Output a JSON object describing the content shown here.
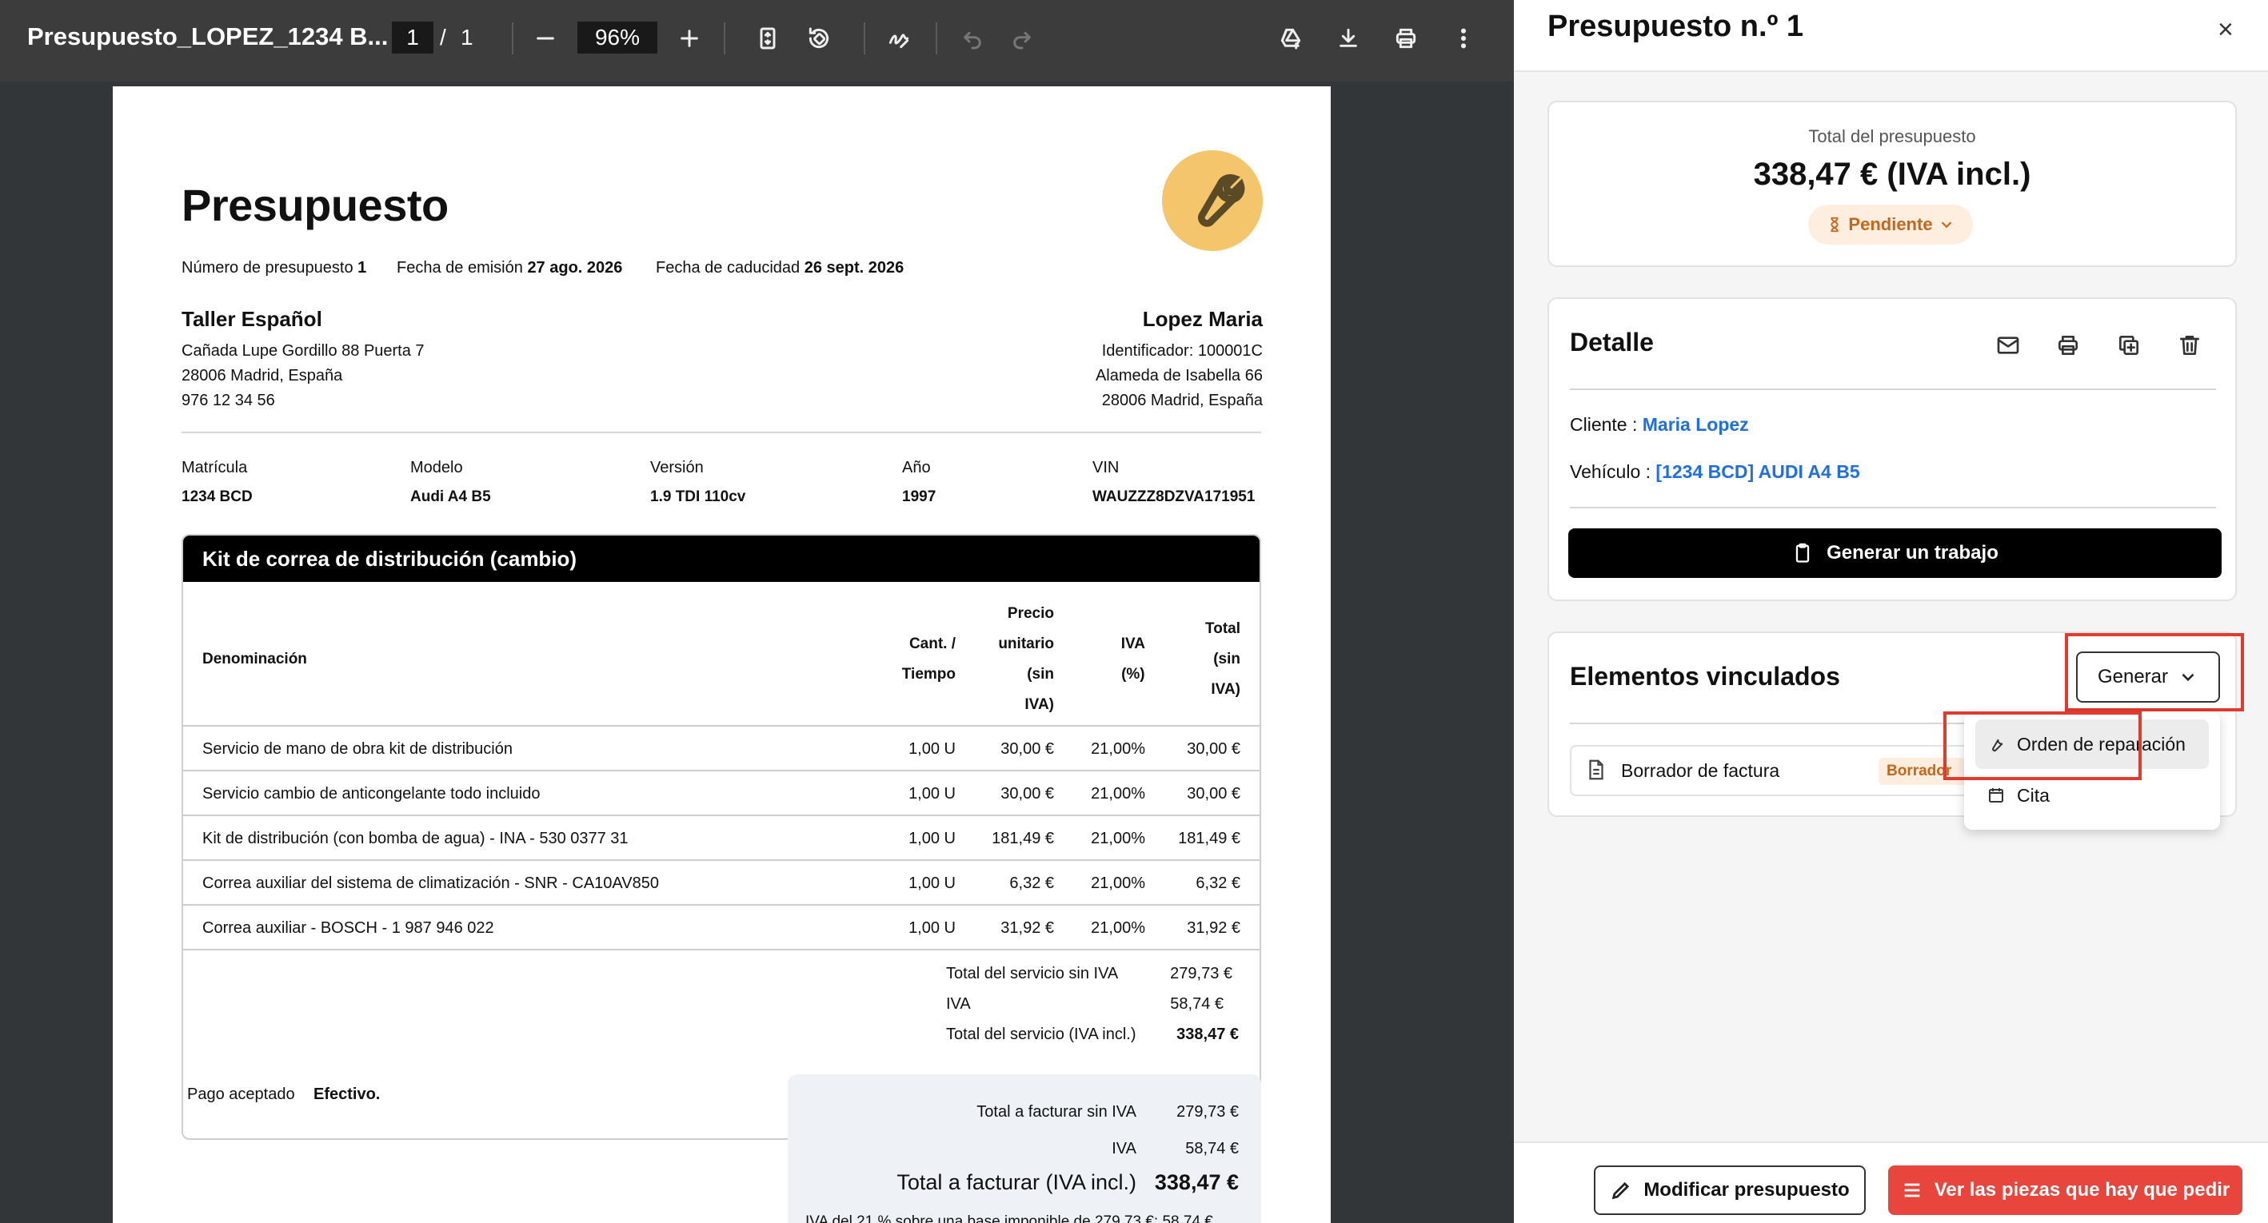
{
  "viewer": {
    "filename": "Presupuesto_LOPEZ_1234 B...",
    "page_current": "1",
    "page_sep": "/",
    "page_total": "1",
    "zoom": "96%"
  },
  "doc": {
    "title": "Presupuesto",
    "meta": {
      "number_label": "Número de presupuesto",
      "number": "1",
      "issue_label": "Fecha de emisión",
      "issue": "27 ago. 2026",
      "expiry_label": "Fecha de caducidad",
      "expiry": "26 sept. 2026"
    },
    "from": {
      "name": "Taller Español",
      "lines": [
        "Cañada Lupe Gordillo 88 Puerta 7",
        "28006 Madrid, España",
        "976 12 34 56"
      ]
    },
    "to": {
      "name": "Lopez Maria",
      "lines": [
        "Identificador: 100001C",
        "Alameda de Isabella 66",
        "28006 Madrid, España"
      ]
    },
    "vehicle": {
      "labels": [
        "Matrícula",
        "Modelo",
        "Versión",
        "Año",
        "VIN"
      ],
      "values": [
        "1234 BCD",
        "Audi A4 B5",
        "1.9 TDI 110cv",
        "1997",
        "WAUZZZ8DZVA171951"
      ]
    },
    "section": {
      "title": "Kit de correa de distribución (cambio)",
      "headers": {
        "name": "Denominación",
        "qty": [
          "Cant. /",
          "Tiempo"
        ],
        "price": [
          "Precio",
          "unitario",
          "(sin",
          "IVA)"
        ],
        "vat": [
          "IVA",
          "(%)"
        ],
        "total": [
          "Total",
          "(sin",
          "IVA)"
        ]
      },
      "rows": [
        {
          "name": "Servicio de mano de obra kit de distribución",
          "qty": "1,00 U",
          "price": "30,00 €",
          "vat": "21,00%",
          "total": "30,00 €"
        },
        {
          "name": "Servicio cambio de anticongelante todo incluido",
          "qty": "1,00 U",
          "price": "30,00 €",
          "vat": "21,00%",
          "total": "30,00 €"
        },
        {
          "name": "Kit de distribución (con bomba de agua) - INA - 530 0377 31",
          "qty": "1,00 U",
          "price": "181,49 €",
          "vat": "21,00%",
          "total": "181,49 €"
        },
        {
          "name": "Correa auxiliar del sistema de climatización - SNR - CA10AV850",
          "qty": "1,00 U",
          "price": "6,32 €",
          "vat": "21,00%",
          "total": "6,32 €"
        },
        {
          "name": "Correa auxiliar - BOSCH - 1 987 946 022",
          "qty": "1,00 U",
          "price": "31,92 €",
          "vat": "21,00%",
          "total": "31,92 €"
        }
      ],
      "subtotals": [
        {
          "label": "Total del servicio sin IVA",
          "value": "279,73 €"
        },
        {
          "label": "IVA",
          "value": "58,74 €"
        },
        {
          "label": "Total del servicio (IVA incl.)",
          "value": "338,47 €"
        }
      ]
    },
    "payment_label": "Pago aceptado",
    "payment_value": "Efectivo.",
    "totals": [
      {
        "label": "Total a facturar sin IVA",
        "value": "279,73 €"
      },
      {
        "label": "IVA",
        "value": "58,74 €"
      },
      {
        "label": "Total a facturar (IVA incl.)",
        "value": "338,47 €"
      }
    ],
    "footnote": "IVA del 21 % sobre una base imponible de 279,73 €: 58,74 €"
  },
  "panel": {
    "title": "Presupuesto n.º 1",
    "close": "×",
    "total_label": "Total del presupuesto",
    "total_value": "338,47 € (IVA incl.)",
    "status": "Pendiente",
    "detail_title": "Detalle",
    "client_label": "Cliente :",
    "client_value": "Maria Lopez",
    "vehicle_label": "Vehículo :",
    "vehicle_value": "[1234 BCD] AUDI A4 B5",
    "generate_job": "Generar un trabajo",
    "linked_title": "Elementos vinculados",
    "generate": "Generar",
    "linked_item": "Borrador de factura",
    "linked_badge": "Borrador",
    "menu": [
      "Orden de reparación",
      "Cita"
    ],
    "modify": "Modificar presupuesto",
    "parts": "Ver las piezas que hay que pedir"
  },
  "colors": {
    "accent": "#1f6fe0",
    "status_bg": "#fdeee0",
    "status_fg": "#c5661a",
    "danger": "#e8453c",
    "highlight": "#e03b2e"
  }
}
